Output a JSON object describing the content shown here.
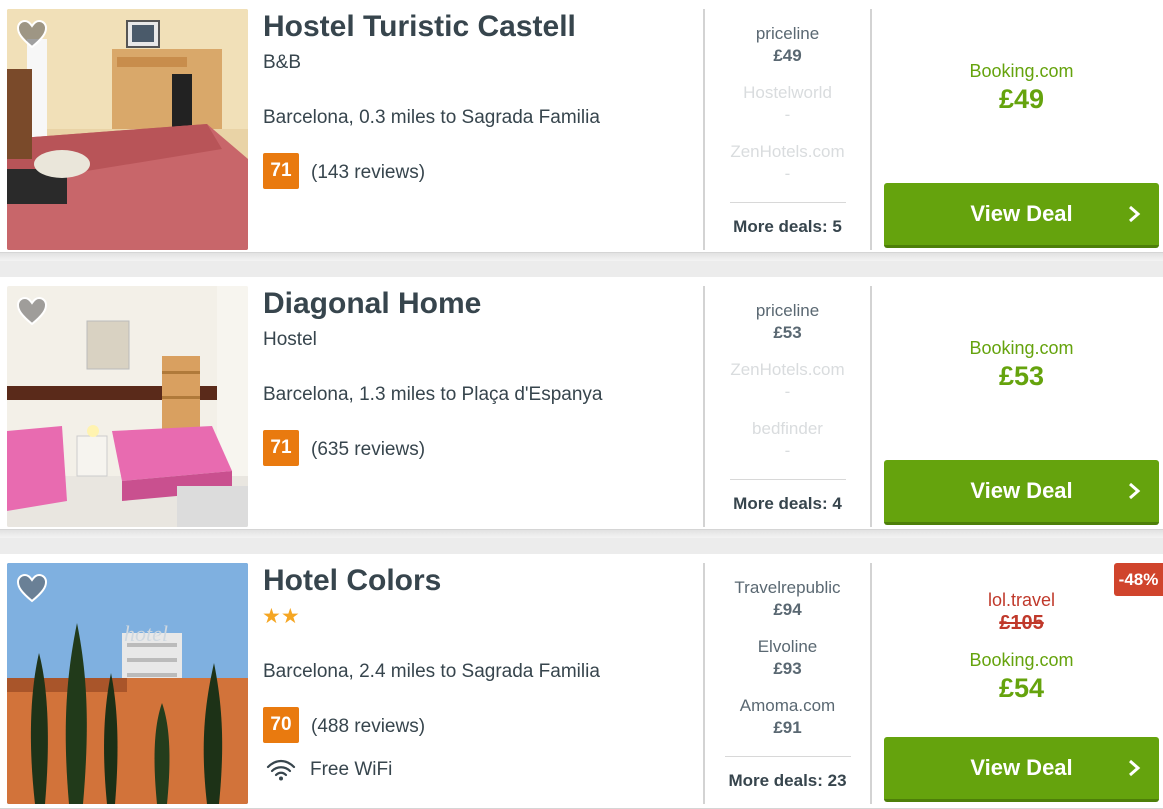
{
  "colors": {
    "deal_green": "#65a30d",
    "rating_orange": "#e97a0f",
    "discount_red": "#d0442c",
    "strike_red": "#c0392b",
    "star_gold": "#f5a623"
  },
  "hotels": [
    {
      "name": "Hostel Turistic Castell",
      "type": "B&B",
      "location": "Barcelona, 0.3 miles to Sagrada Familia",
      "rating": "71",
      "reviews": "(143 reviews)",
      "partners": [
        {
          "name": "priceline",
          "price": "£49",
          "faded": false
        },
        {
          "name": "Hostelworld",
          "price": "-",
          "faded": true
        },
        {
          "name": "ZenHotels.com",
          "price": "-",
          "faded": true
        }
      ],
      "more_deals": "More deals: 5",
      "deal_site": "Booking.com",
      "deal_price": "£49",
      "view_deal": "View Deal",
      "image": "bedroom-photo"
    },
    {
      "name": "Diagonal Home",
      "type": "Hostel",
      "location": "Barcelona, 1.3 miles to Plaça d'Espanya",
      "rating": "71",
      "reviews": "(635 reviews)",
      "partners": [
        {
          "name": "priceline",
          "price": "£53",
          "faded": false
        },
        {
          "name": "ZenHotels.com",
          "price": "-",
          "faded": true
        },
        {
          "name": "bedfinder",
          "price": "-",
          "faded": true
        }
      ],
      "more_deals": "More deals: 4",
      "deal_site": "Booking.com",
      "deal_price": "£53",
      "view_deal": "View Deal",
      "image": "twin-room-photo"
    },
    {
      "name": "Hotel Colors",
      "stars": "★★",
      "location": "Barcelona, 2.4 miles to Sagrada Familia",
      "rating": "70",
      "reviews": "(488 reviews)",
      "amenity": "Free WiFi",
      "amenity_icon": "wifi-icon",
      "partners": [
        {
          "name": "Travelrepublic",
          "price": "£94",
          "faded": false
        },
        {
          "name": "Elvoline",
          "price": "£93",
          "faded": false
        },
        {
          "name": "Amoma.com",
          "price": "£91",
          "faded": false
        }
      ],
      "more_deals": "More deals: 23",
      "strike_site": "lol.travel",
      "strike_price": "£105",
      "deal_site": "Booking.com",
      "deal_price": "£54",
      "discount": "-48%",
      "view_deal": "View Deal",
      "image": "hotel-exterior-photo"
    }
  ]
}
